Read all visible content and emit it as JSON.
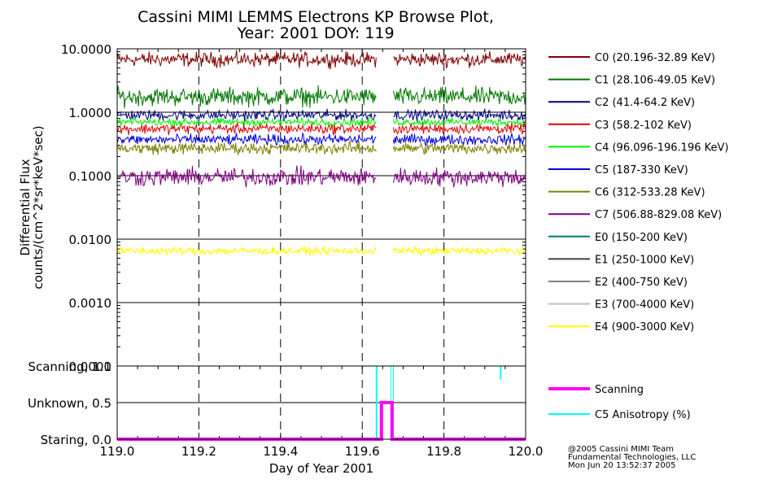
{
  "chart_data": {
    "type": "line",
    "title": "Cassini MIMI LEMMS Electrons KP Browse Plot,",
    "subtitle": "Year: 2001 DOY: 119",
    "xlabel": "Day of Year 2001",
    "xlim": [
      119.0,
      120.0
    ],
    "x_ticks": [
      "119.0",
      "119.2",
      "119.4",
      "119.6",
      "119.8",
      "120.0"
    ],
    "upper_panel": {
      "ylabel_line1": "Differential Flux",
      "ylabel_line2": "counts/(cm^2*sr*keV*sec)",
      "yscale": "log",
      "ylim": [
        0.0001,
        10
      ],
      "y_ticks": [
        "10.0000",
        "1.0000",
        "0.1000",
        "0.0100",
        "0.0010",
        "0.0001"
      ],
      "data_gap": [
        119.635,
        119.675
      ],
      "series": [
        {
          "name": "C0 (20.196-32.89 KeV)",
          "color": "#800000",
          "level": 6.8,
          "noise": 0.055
        },
        {
          "name": "C1 (28.106-49.05 KeV)",
          "color": "#007800",
          "level": 1.75,
          "noise": 0.07
        },
        {
          "name": "C2 (41.4-64.2 KeV)",
          "color": "#000080",
          "level": 0.9,
          "noise": 0.04
        },
        {
          "name": "C3 (58.2-102 KeV)",
          "color": "#e00000",
          "level": 0.55,
          "noise": 0.04
        },
        {
          "name": "C4 (96.096-196.196 KeV)",
          "color": "#00ee00",
          "level": 0.7,
          "noise": 0.03
        },
        {
          "name": "C5 (187-330 KeV)",
          "color": "#0000e0",
          "level": 0.37,
          "noise": 0.04
        },
        {
          "name": "C6 (312-533.28 KeV)",
          "color": "#808000",
          "level": 0.27,
          "noise": 0.045
        },
        {
          "name": "C7 (506.88-829.08 KeV)",
          "color": "#800080",
          "level": 0.095,
          "noise": 0.07
        },
        {
          "name": "E0 (150-200 KeV)",
          "color": "#007878",
          "level": null,
          "noise": 0
        },
        {
          "name": "E1 (250-1000 KeV)",
          "color": "#404040",
          "level": null,
          "noise": 0
        },
        {
          "name": "E2 (400-750 KeV)",
          "color": "#808080",
          "level": null,
          "noise": 0
        },
        {
          "name": "E3 (700-4000 KeV)",
          "color": "#c0c0c0",
          "level": null,
          "noise": 0
        },
        {
          "name": "E4 (900-3000 KeV)",
          "color": "#ffff00",
          "level": 0.0065,
          "noise": 0.03
        }
      ]
    },
    "lower_panel": {
      "y_ticks": [
        "Scanning, 1.0",
        "Unknown, 0.5",
        "Staring, 0.0"
      ],
      "ylim": [
        0,
        1.0
      ],
      "series": [
        {
          "name": "Scanning",
          "color": "#ff00ff",
          "points": [
            [
              119.0,
              0.0
            ],
            [
              119.647,
              0.0
            ],
            [
              119.647,
              0.5
            ],
            [
              119.673,
              0.5
            ],
            [
              119.673,
              0.0
            ],
            [
              120.0,
              0.0
            ]
          ]
        },
        {
          "name": "C5 Anisotropy (%)",
          "color": "#00ffff",
          "points": [
            [
              119.0,
              1.0
            ],
            [
              119.634,
              1.0
            ],
            [
              119.634,
              0.0
            ],
            [
              119.636,
              0.0
            ],
            [
              119.636,
              1.0
            ],
            [
              119.67,
              1.0
            ],
            [
              119.67,
              0.0
            ],
            [
              119.676,
              0.0
            ],
            [
              119.676,
              1.0
            ],
            [
              119.938,
              1.0
            ],
            [
              119.938,
              0.82
            ],
            [
              119.94,
              0.82
            ],
            [
              119.94,
              1.0
            ],
            [
              120.0,
              1.0
            ]
          ]
        }
      ]
    }
  },
  "credit": {
    "line1": "@2005 Cassini MIMI Team",
    "line2": "Fundamental Technologies, LLC",
    "line3": "Mon Jun 20 13:52:37 2005"
  }
}
